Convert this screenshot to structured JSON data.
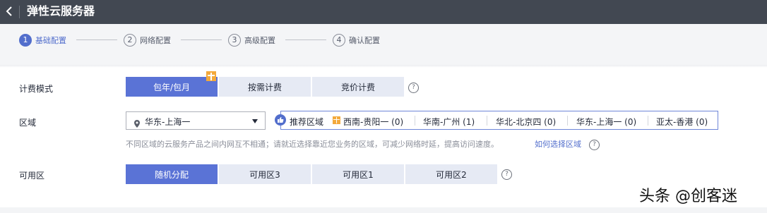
{
  "header": {
    "title": "弹性云服务器",
    "back_icon": "back-chevron-icon"
  },
  "steps": [
    {
      "num": "1",
      "label": "基础配置",
      "active": true
    },
    {
      "num": "2",
      "label": "网络配置",
      "active": false
    },
    {
      "num": "3",
      "label": "高级配置",
      "active": false
    },
    {
      "num": "4",
      "label": "确认配置",
      "active": false
    }
  ],
  "billing": {
    "label": "计费模式",
    "options": [
      "包年/包月",
      "按需计费",
      "竞价计费"
    ],
    "selected": "包年/包月",
    "help": "?"
  },
  "region": {
    "label": "区域",
    "value": "华东-上海一",
    "recommend_label": "推荐区域",
    "recommended": [
      {
        "name": "西南-贵阳一",
        "count": "(0)"
      },
      {
        "name": "华南-广州",
        "count": "(1)"
      },
      {
        "name": "华北-北京四",
        "count": "(0)"
      },
      {
        "name": "华东-上海一",
        "count": "(0)"
      },
      {
        "name": "亚太-香港",
        "count": "(0)"
      }
    ],
    "hint": "不同区域的云服务产品之间内网互不相通；请就近选择靠近您业务的区域，可减少网络时延，提高访问速度。",
    "link": "如何选择区域"
  },
  "az": {
    "label": "可用区",
    "options": [
      "随机分配",
      "可用区3",
      "可用区1",
      "可用区2"
    ],
    "selected": "随机分配",
    "help": "?"
  },
  "watermark": "头条 @创客迷",
  "colors": {
    "header_bg": "#424852",
    "accent": "#526ecc",
    "selected_bg": "#5a73d6",
    "option_bg": "#e6eaf4",
    "gift": "#f3a93b"
  }
}
